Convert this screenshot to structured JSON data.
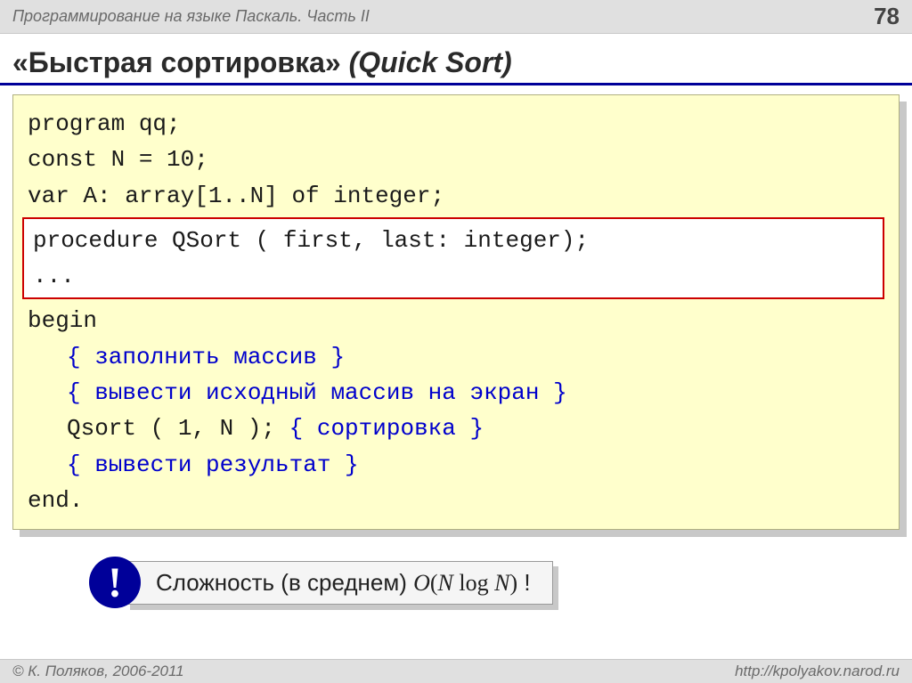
{
  "header": {
    "course": "Программирование на языке Паскаль. Часть II",
    "page": "78"
  },
  "title": {
    "ru": "«Быстрая сортировка»",
    "en": "(Quick Sort)"
  },
  "code": {
    "l1": "program qq;",
    "l2": "const N = 10;",
    "l3": "var A: array[1..N] of integer;",
    "box1": "procedure QSort ( first, last: integer);",
    "box2": "...",
    "l4": "begin",
    "c1": "{ заполнить массив }",
    "c2": "{ вывести исходный массив на экран }",
    "l5a": "Qsort ( 1, N ); ",
    "l5b": "{ сортировка }",
    "c3": "{ вывести результат }",
    "l6": "end."
  },
  "note": {
    "bang": "!",
    "text_a": "Сложность (в среднем) ",
    "bigO_open": "O",
    "bigO_paren1": "(",
    "bigO_N1": "N",
    "bigO_log": " log ",
    "bigO_N2": "N",
    "bigO_paren2": ")",
    "tail": " !"
  },
  "footer": {
    "left": "© К. Поляков, 2006-2011",
    "right": "http://kpolyakov.narod.ru"
  }
}
